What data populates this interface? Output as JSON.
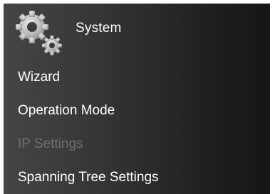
{
  "header": {
    "title": "System",
    "icon": "gears-icon"
  },
  "menu": {
    "items": [
      {
        "label": "Wizard",
        "enabled": true
      },
      {
        "label": "Operation Mode",
        "enabled": true
      },
      {
        "label": "IP Settings",
        "enabled": false
      },
      {
        "label": "Spanning Tree Settings",
        "enabled": true
      }
    ]
  },
  "colors": {
    "text": "#ffffff",
    "disabled_text": "#6e6e6e",
    "icon": "#c8c8c8"
  }
}
